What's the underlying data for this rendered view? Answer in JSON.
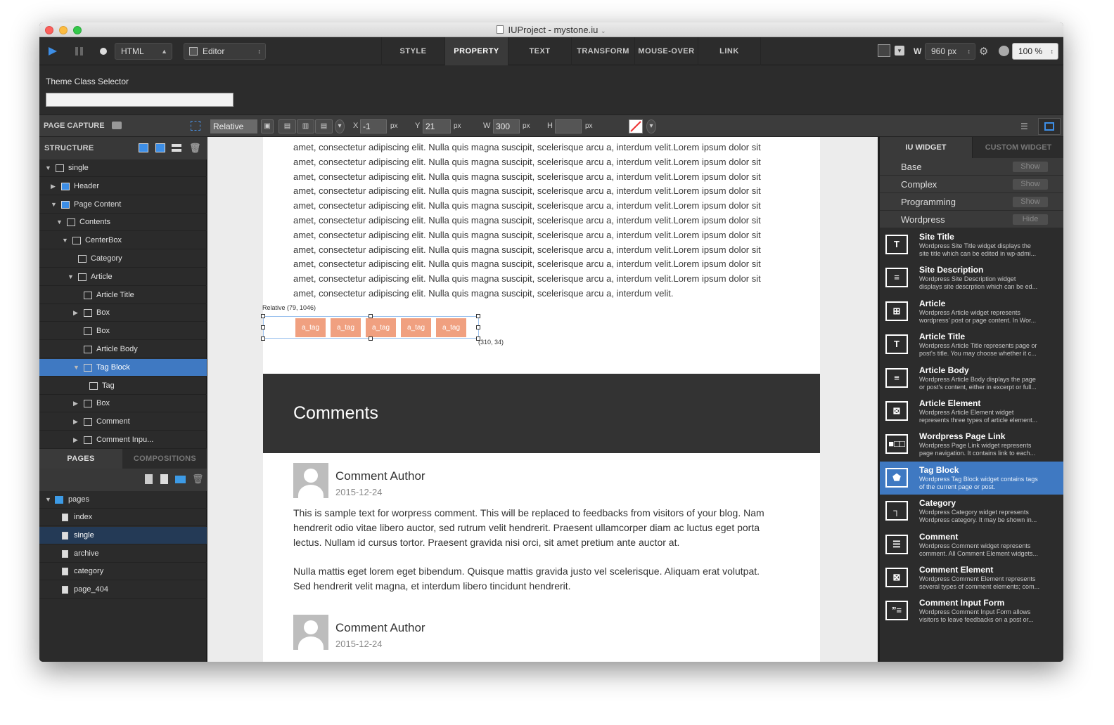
{
  "window": {
    "title": "IUProject - mystone.iu"
  },
  "toolbar": {
    "doc_type": "HTML",
    "mode": "Editor",
    "tabs": [
      "STYLE",
      "PROPERTY",
      "TEXT",
      "TRANSFORM",
      "MOUSE-OVER",
      "LINK"
    ],
    "active_tab": "PROPERTY",
    "width_label": "W",
    "width_value": "960 px",
    "zoom_value": "100 %"
  },
  "theme": {
    "label": "Theme Class Selector",
    "value": ""
  },
  "propbar": {
    "page_capture": "PAGE CAPTURE",
    "position": "Relative",
    "x_label": "X",
    "x": "-1",
    "y_label": "Y",
    "y": "21",
    "w_label": "W",
    "w": "300",
    "h_label": "H",
    "h": "",
    "unit": "px"
  },
  "structure": {
    "header": "STRUCTURE",
    "items": [
      {
        "label": "single",
        "depth": 0,
        "toggle": "open",
        "icon": "file-icon"
      },
      {
        "label": "Header",
        "depth": 1,
        "toggle": "closed",
        "icon": "header-icon"
      },
      {
        "label": "Page Content",
        "depth": 1,
        "toggle": "open",
        "icon": "page-content-icon"
      },
      {
        "label": "Contents",
        "depth": 2,
        "toggle": "open",
        "icon": "contents-icon"
      },
      {
        "label": "CenterBox",
        "depth": 3,
        "toggle": "open",
        "icon": "centerbox-icon"
      },
      {
        "label": "Category",
        "depth": 4,
        "toggle": "none",
        "icon": "category-icon"
      },
      {
        "label": "Article",
        "depth": 4,
        "toggle": "open",
        "icon": "article-icon"
      },
      {
        "label": "Article Title",
        "depth": 5,
        "toggle": "none",
        "icon": "article-title-icon"
      },
      {
        "label": "Box",
        "depth": 5,
        "toggle": "closed",
        "icon": "box-icon"
      },
      {
        "label": "Box",
        "depth": 5,
        "toggle": "none",
        "icon": "box-icon"
      },
      {
        "label": "Article Body",
        "depth": 5,
        "toggle": "none",
        "icon": "article-body-icon"
      },
      {
        "label": "Tag Block",
        "depth": 5,
        "toggle": "open",
        "icon": "tag-block-icon"
      },
      {
        "label": "Tag",
        "depth": 6,
        "toggle": "none",
        "icon": "tag-icon"
      },
      {
        "label": "Box",
        "depth": 5,
        "toggle": "closed",
        "icon": "box-icon"
      },
      {
        "label": "Comment",
        "depth": 5,
        "toggle": "closed",
        "icon": "comment-icon"
      },
      {
        "label": "Comment Inpu...",
        "depth": 5,
        "toggle": "closed",
        "icon": "comment-input-icon"
      }
    ],
    "selected_index": 11
  },
  "pages_panel": {
    "tabs": [
      "PAGES",
      "COMPOSITIONS"
    ],
    "active_tab": "PAGES",
    "folder": "pages",
    "items": [
      "index",
      "single",
      "archive",
      "category",
      "page_404"
    ],
    "selected": "single"
  },
  "canvas": {
    "lorem_lines": [
      "amet, consectetur adipiscing elit. Nulla quis magna suscipit, scelerisque arcu a, interdum velit.Lorem ipsum dolor sit",
      "amet, consectetur adipiscing elit. Nulla quis magna suscipit, scelerisque arcu a, interdum velit.Lorem ipsum dolor sit",
      "amet, consectetur adipiscing elit. Nulla quis magna suscipit, scelerisque arcu a, interdum velit.Lorem ipsum dolor sit",
      "amet, consectetur adipiscing elit. Nulla quis magna suscipit, scelerisque arcu a, interdum velit.Lorem ipsum dolor sit",
      "amet, consectetur adipiscing elit. Nulla quis magna suscipit, scelerisque arcu a, interdum velit.Lorem ipsum dolor sit",
      "amet, consectetur adipiscing elit. Nulla quis magna suscipit, scelerisque arcu a, interdum velit.Lorem ipsum dolor sit",
      "amet, consectetur adipiscing elit. Nulla quis magna suscipit, scelerisque arcu a, interdum velit.Lorem ipsum dolor sit",
      "amet, consectetur adipiscing elit. Nulla quis magna suscipit, scelerisque arcu a, interdum velit.Lorem ipsum dolor sit",
      "amet, consectetur adipiscing elit. Nulla quis magna suscipit, scelerisque arcu a, interdum velit.Lorem ipsum dolor sit",
      "amet, consectetur adipiscing elit. Nulla quis magna suscipit, scelerisque arcu a, interdum velit.Lorem ipsum dolor sit",
      "amet, consectetur adipiscing elit. Nulla quis magna suscipit, scelerisque arcu a, interdum velit."
    ],
    "selection_label": "Relative (79, 1046)",
    "selection_size": "(310, 34)",
    "tags": [
      "a_tag",
      "a_tag",
      "a_tag",
      "a_tag",
      "a_tag"
    ],
    "comments_title": "Comments",
    "comments": [
      {
        "author": "Comment Author",
        "date": "2015-12-24",
        "lines": [
          "This is sample text for worpress comment. This will be replaced to feedbacks from visitors of your blog. Nam",
          "hendrerit odio vitae libero auctor, sed rutrum velit hendrerit. Praesent ullamcorper diam ac luctus eget porta",
          "lectus. Nullam id cursus tortor. Praesent gravida nisi orci, sit amet pretium ante auctor at.",
          "",
          "Nulla mattis eget lorem eget bibendum. Quisque mattis gravida justo vel scelerisque. Aliquam erat volutpat.",
          "Sed hendrerit velit magna, et interdum libero tincidunt hendrerit."
        ]
      },
      {
        "author": "Comment Author",
        "date": "2015-12-24",
        "lines": []
      }
    ]
  },
  "widgets_panel": {
    "tabs": [
      "IU WIDGET",
      "CUSTOM WIDGET"
    ],
    "active_tab": "IU WIDGET",
    "categories": [
      {
        "name": "Base",
        "button": "Show"
      },
      {
        "name": "Complex",
        "button": "Show"
      },
      {
        "name": "Programming",
        "button": "Show"
      },
      {
        "name": "Wordpress",
        "button": "Hide"
      }
    ],
    "widgets": [
      {
        "name": "Site Title",
        "desc1": "Wordpress Site Title widget displays the",
        "desc2": "site title which can be edited in wp-admi...",
        "icon": "title-widget-icon"
      },
      {
        "name": "Site Description",
        "desc1": "Wordpress Site Description widget",
        "desc2": "displays site descrption which can be ed...",
        "icon": "description-widget-icon"
      },
      {
        "name": "Article",
        "desc1": "Wordpress Article widget represents",
        "desc2": "wordpress' post or page content. In Wor...",
        "icon": "article-widget-icon"
      },
      {
        "name": "Article Title",
        "desc1": "Wordpress Article Title represents page or",
        "desc2": "post's title. You may choose whether it c...",
        "icon": "article-title-widget-icon"
      },
      {
        "name": "Article Body",
        "desc1": "Wordpress Article Body displays the page",
        "desc2": "or post's content, either in excerpt or full...",
        "icon": "article-body-widget-icon"
      },
      {
        "name": "Article Element",
        "desc1": "Wordpress Article Element widget",
        "desc2": "represents three types of article element...",
        "icon": "article-element-widget-icon"
      },
      {
        "name": "Wordpress Page Link",
        "desc1": "Wordpress Page Link widget represents",
        "desc2": "page navigation. It contains link to each...",
        "icon": "page-link-widget-icon"
      },
      {
        "name": "Tag Block",
        "desc1": "Wordpress Tag Block widget contains tags",
        "desc2": "of the current page or post.",
        "icon": "tag-block-widget-icon"
      },
      {
        "name": "Category",
        "desc1": "Wordpress Category widget represents",
        "desc2": "Wordpress category. It may be shown in...",
        "icon": "category-widget-icon"
      },
      {
        "name": "Comment",
        "desc1": "Wordpress Comment widget represents",
        "desc2": "comment. All Comment Element widgets...",
        "icon": "comment-widget-icon"
      },
      {
        "name": "Comment Element",
        "desc1": "Wordpress Comment Element represents",
        "desc2": "several types of comment elements; com...",
        "icon": "comment-element-widget-icon"
      },
      {
        "name": "Comment Input Form",
        "desc1": "Wordpress Comment Input Form allows",
        "desc2": "visitors to leave feedbacks on a post or...",
        "icon": "comment-input-widget-icon"
      }
    ],
    "selected": "Tag Block"
  },
  "colors": {
    "selection": "#3f79c2",
    "tag": "#f0a080",
    "dark_band": "#333333"
  }
}
